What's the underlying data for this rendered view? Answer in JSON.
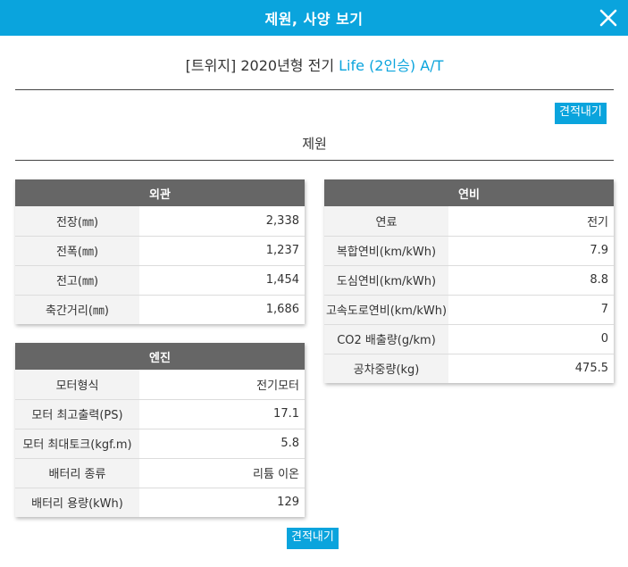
{
  "header": {
    "title": "제원, 사양 보기"
  },
  "car": {
    "title_prefix": "[트위지] 2020년형 전기 ",
    "trim": "Life (2인승) A/T"
  },
  "buttons": {
    "estimate": "견적내기"
  },
  "section": {
    "title": "제원"
  },
  "exterior": {
    "title": "외관",
    "rows": [
      {
        "label": "전장(㎜)",
        "value": "2,338"
      },
      {
        "label": "전폭(㎜)",
        "value": "1,237"
      },
      {
        "label": "전고(㎜)",
        "value": "1,454"
      },
      {
        "label": "축간거리(㎜)",
        "value": "1,686"
      }
    ]
  },
  "engine": {
    "title": "엔진",
    "rows": [
      {
        "label": "모터형식",
        "value": "전기모터"
      },
      {
        "label": "모터 최고출력(PS)",
        "value": "17.1"
      },
      {
        "label": "모터 최대토크(kgf.m)",
        "value": "5.8"
      },
      {
        "label": "배터리 종류",
        "value": "리튬 이온"
      },
      {
        "label": "배터리 용량(kWh)",
        "value": "129"
      }
    ]
  },
  "fuel": {
    "title": "연비",
    "rows": [
      {
        "label": "연료",
        "value": "전기"
      },
      {
        "label": "복합연비(km/kWh)",
        "value": "7.9"
      },
      {
        "label": "도심연비(km/kWh)",
        "value": "8.8"
      },
      {
        "label": "고속도로연비(km/kWh)",
        "value": "7"
      },
      {
        "label": "CO2 배출량(g/km)",
        "value": "0"
      },
      {
        "label": "공차중량(kg)",
        "value": "475.5"
      }
    ]
  },
  "colors": {
    "accent": "#0aa4dd",
    "table_header": "#666666"
  }
}
